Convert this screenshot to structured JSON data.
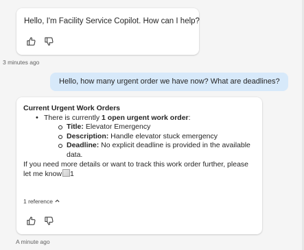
{
  "bot_greeting": {
    "text": "Hello, I'm Facility Service Copilot. How can I help?",
    "timestamp": "3 minutes ago"
  },
  "user_message": {
    "text": "Hello, how many urgent order we have now? What are deadlines?"
  },
  "bot_reply": {
    "heading": "Current Urgent Work Orders",
    "bullet_prefix": "There is currently ",
    "bullet_bold": "1 open urgent work order",
    "bullet_suffix": ":",
    "details": [
      {
        "label": "Title:",
        "value": " Elevator Emergency"
      },
      {
        "label": "Description:",
        "value": " Handle elevator stuck emergency"
      },
      {
        "label": "Deadline:",
        "value": " No explicit deadline is provided in the available data."
      }
    ],
    "closing": "If you need more details or want to track this work order further, please let me know",
    "citation": "1",
    "references": "1 reference",
    "timestamp": "A minute ago"
  },
  "icons": [
    "thumbs-up-icon",
    "thumbs-down-icon",
    "chevron-up-icon",
    "broken-image-icon"
  ]
}
